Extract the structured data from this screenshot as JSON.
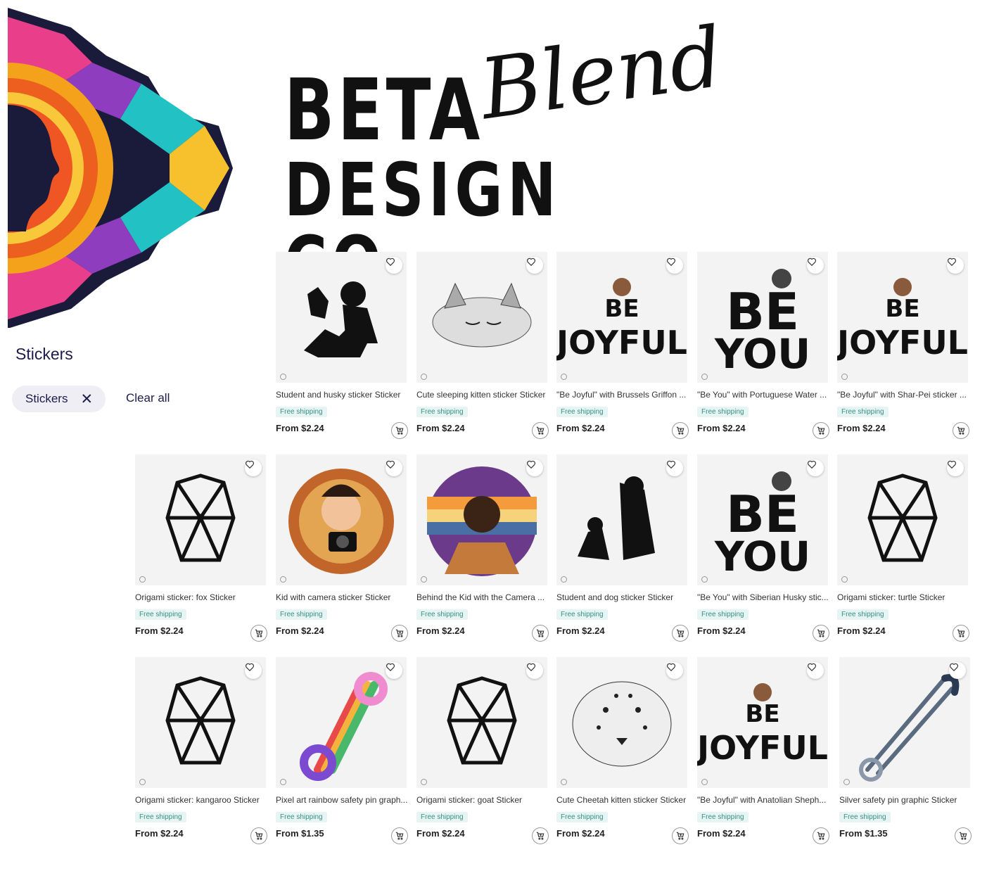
{
  "brand": {
    "line1": "BETA",
    "script": "Blend",
    "line2": "DESIGN CO."
  },
  "sidebar": {
    "title": "Stickers",
    "chip_label": "Stickers",
    "clear_all": "Clear all"
  },
  "shipping_label": "Free shipping",
  "products": [
    {
      "title": "Student and husky sticker Sticker",
      "price": "From $2.24",
      "art": "student-husky"
    },
    {
      "title": "Cute sleeping kitten sticker Sticker",
      "price": "From $2.24",
      "art": "kitten"
    },
    {
      "title": "\"Be Joyful\" with Brussels Griffon ...",
      "price": "From $2.24",
      "art": "be-joyful"
    },
    {
      "title": "\"Be You\" with Portuguese Water ...",
      "price": "From $2.24",
      "art": "be-you"
    },
    {
      "title": "\"Be Joyful\" with Shar-Pei sticker ...",
      "price": "From $2.24",
      "art": "be-joyful"
    },
    {
      "title": "Origami sticker: fox Sticker",
      "price": "From $2.24",
      "art": "origami"
    },
    {
      "title": "Kid with camera sticker Sticker",
      "price": "From $2.24",
      "art": "kid-camera"
    },
    {
      "title": "Behind the Kid with the Camera ...",
      "price": "From $2.24",
      "art": "kid-back"
    },
    {
      "title": "Student and dog sticker Sticker",
      "price": "From $2.24",
      "art": "student-dog"
    },
    {
      "title": "\"Be You\" with Siberian Husky stic...",
      "price": "From $2.24",
      "art": "be-you"
    },
    {
      "title": "Origami sticker: turtle Sticker",
      "price": "From $2.24",
      "art": "origami"
    },
    {
      "title": "Origami sticker: kangaroo Sticker",
      "price": "From $2.24",
      "art": "origami"
    },
    {
      "title": "Pixel art rainbow safety pin graph...",
      "price": "From $1.35",
      "art": "rainbow-pin"
    },
    {
      "title": "Origami sticker: goat Sticker",
      "price": "From $2.24",
      "art": "origami"
    },
    {
      "title": "Cute Cheetah kitten sticker Sticker",
      "price": "From $2.24",
      "art": "cheetah"
    },
    {
      "title": "\"Be Joyful\" with Anatolian Sheph...",
      "price": "From $2.24",
      "art": "be-joyful"
    },
    {
      "title": "Silver safety pin graphic Sticker",
      "price": "From $1.35",
      "art": "silver-pin"
    }
  ]
}
